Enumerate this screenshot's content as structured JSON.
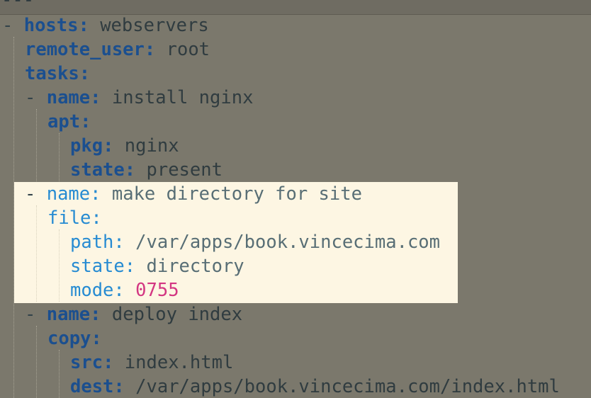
{
  "document_start": "---",
  "lines": [
    {
      "dash": "- ",
      "key": "hosts",
      "sep": ": ",
      "value": "webservers"
    },
    {
      "key": "remote_user",
      "sep": ": ",
      "value": "root"
    },
    {
      "key": "tasks",
      "sep": ":"
    },
    {
      "dash": "- ",
      "key": "name",
      "sep": ": ",
      "value": "install nginx"
    },
    {
      "key": "apt",
      "sep": ":"
    },
    {
      "key": "pkg",
      "sep": ": ",
      "value": "nginx"
    },
    {
      "key": "state",
      "sep": ": ",
      "value": "present"
    },
    {
      "dash": "- ",
      "key": "name",
      "sep": ": ",
      "value": "make directory for site"
    },
    {
      "key": "file",
      "sep": ":"
    },
    {
      "key": "path",
      "sep": ": ",
      "value": "/var/apps/book.vincecima.com"
    },
    {
      "key": "state",
      "sep": ": ",
      "value": "directory"
    },
    {
      "key": "mode",
      "sep": ": ",
      "value": "0755"
    },
    {
      "dash": "- ",
      "key": "name",
      "sep": ": ",
      "value": "deploy index"
    },
    {
      "key": "copy",
      "sep": ":"
    },
    {
      "key": "src",
      "sep": ": ",
      "value": "index.html"
    },
    {
      "key": "dest",
      "sep": ": ",
      "value": "/var/apps/book.vincecima.com/index.html"
    }
  ],
  "colors": {
    "background": "#7b786c",
    "highlight_background": "#fdf6e3",
    "key": "#1b4f8f",
    "highlight_key": "#268bd2",
    "number": "#d33682"
  }
}
